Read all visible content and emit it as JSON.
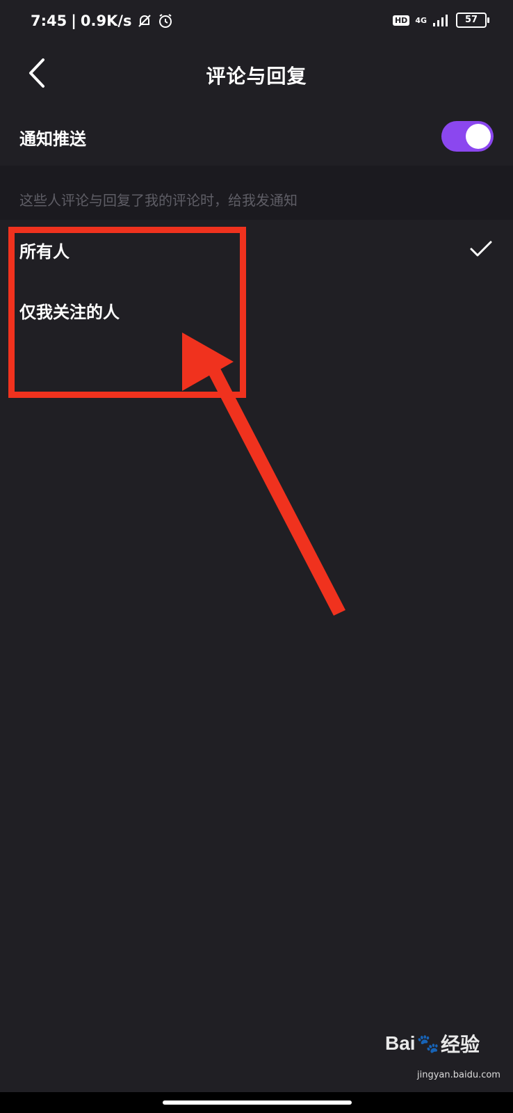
{
  "status_bar": {
    "time": "7:45",
    "separator": "|",
    "speed": "0.9K/s",
    "hd": "HD",
    "network": "4G",
    "battery": "57",
    "icons": [
      "bell-mute-icon",
      "alarm-icon",
      "signal-icon"
    ]
  },
  "header": {
    "title": "评论与回复",
    "back_icon": "chevron-left-icon"
  },
  "push": {
    "label": "通知推送",
    "enabled": true
  },
  "hint": "这些人评论与回复了我的评论时，给我发通知",
  "options": [
    {
      "label": "所有人",
      "selected": true
    },
    {
      "label": "仅我关注的人",
      "selected": false
    }
  ],
  "watermark": {
    "brand_left": "Bai",
    "brand_right": "经验",
    "url": "jingyan.baidu.com"
  },
  "colors": {
    "background": "#201f24",
    "toggle_on": "#8b47ef",
    "annotation": "#f0321e"
  }
}
